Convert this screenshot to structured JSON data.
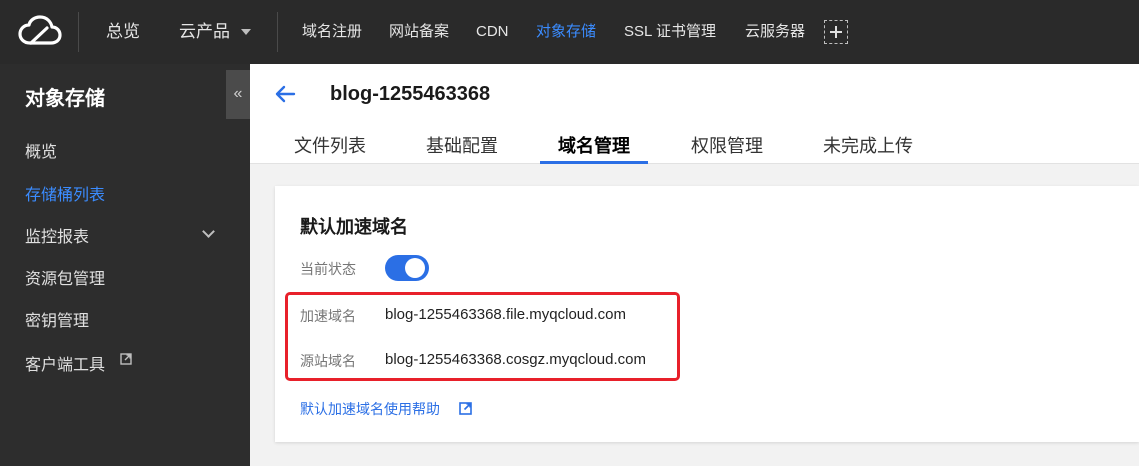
{
  "topbar": {
    "logo_icon": "cloud-icon",
    "overview": "总览",
    "products": "云产品",
    "nav": [
      "域名注册",
      "网站备案",
      "CDN",
      "对象存储",
      "SSL 证书管理",
      "云服务器"
    ],
    "active_nav": "对象存储",
    "add_icon": "plus-icon"
  },
  "sidebar": {
    "title": "对象存储",
    "collapse_glyph": "«",
    "items": [
      "概览",
      "存储桶列表",
      "监控报表",
      "资源包管理",
      "密钥管理",
      "客户端工具"
    ],
    "active_item": "存储桶列表"
  },
  "header": {
    "back_icon": "arrow-left-icon",
    "bucket_name": "blog-1255463368",
    "tabs": [
      "文件列表",
      "基础配置",
      "域名管理",
      "权限管理",
      "未完成上传"
    ],
    "active_tab": "域名管理"
  },
  "card": {
    "title": "默认加速域名",
    "status_label": "当前状态",
    "status_on": true,
    "accel_label": "加速域名",
    "accel_value": "blog-1255463368.file.myqcloud.com",
    "origin_label": "源站域名",
    "origin_value": "blog-1255463368.cosgz.myqcloud.com",
    "help_link": "默认加速域名使用帮助"
  },
  "colors": {
    "accent": "#2b6fe5",
    "highlight": "#e8202a",
    "topbar_bg": "#2a2a2a",
    "sidebar_bg": "#2d2d2d"
  }
}
